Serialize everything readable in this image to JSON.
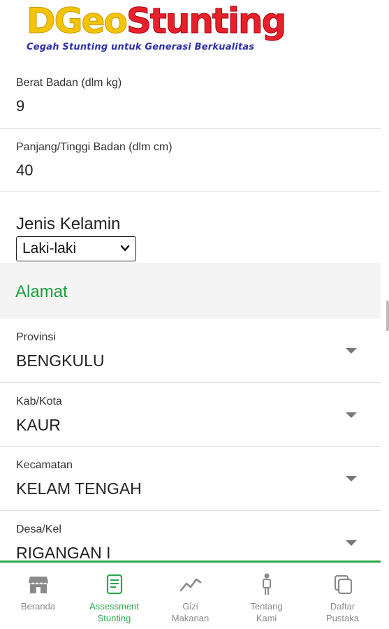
{
  "logo": {
    "title_part1": "DGeo",
    "title_part2": "Stunting",
    "subtitle": "Cegah Stunting untuk Generasi Berkualitas"
  },
  "form": {
    "berat": {
      "label": "Berat Badan (dlm kg)",
      "value": "9"
    },
    "tinggi": {
      "label": "Panjang/Tinggi Badan (dlm cm)",
      "value": "40"
    },
    "kelamin": {
      "label": "Jenis Kelamin",
      "selected": "Laki-laki"
    }
  },
  "alamat": {
    "section_title": "Alamat",
    "provinsi": {
      "label": "Provinsi",
      "value": "BENGKULU"
    },
    "kabkota": {
      "label": "Kab/Kota",
      "value": "KAUR"
    },
    "kecamatan": {
      "label": "Kecamatan",
      "value": "KELAM TENGAH"
    },
    "desa": {
      "label": "Desa/Kel",
      "value": "RIGANGAN I"
    }
  },
  "nav": {
    "items": [
      {
        "line1": "Beranda",
        "line2": "",
        "icon": "store-icon"
      },
      {
        "line1": "Assessment",
        "line2": "Stunting",
        "icon": "document-icon"
      },
      {
        "line1": "Gizi",
        "line2": "Makanan",
        "icon": "trend-icon"
      },
      {
        "line1": "Tentang",
        "line2": "Kami",
        "icon": "person-icon"
      },
      {
        "line1": "Daftar",
        "line2": "Pustaka",
        "icon": "copy-icon"
      }
    ],
    "active_index": 1
  },
  "colors": {
    "accent": "#2aa84a",
    "logo_yellow": "#f5c400",
    "logo_red": "#e8202a",
    "logo_subtitle": "#2c2fa8",
    "section_title": "#1e9e3e"
  }
}
